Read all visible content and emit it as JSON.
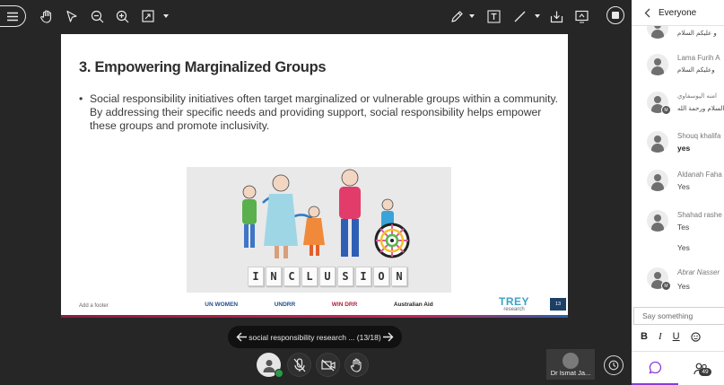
{
  "toolbar": {
    "left_icons": [
      "menu-icon",
      "hand-pan-icon",
      "pointer-icon",
      "zoom-out-icon",
      "zoom-in-icon",
      "fit-page-icon",
      "caret-down-icon"
    ],
    "right_icons": [
      "pen-icon",
      "caret-down-icon",
      "text-tool-icon",
      "line-tool-icon",
      "caret-down-icon",
      "download-icon",
      "share-screen-icon",
      "stop-share-icon"
    ]
  },
  "slide": {
    "title": "3. Empowering Marginalized Groups",
    "bullet": "Social responsibility initiatives often target marginalized or vulnerable groups within a community. By addressing their specific needs and providing support, social responsibility helps empower these groups and promote inclusivity.",
    "image_tiles": [
      "I",
      "N",
      "C",
      "L",
      "U",
      "S",
      "I",
      "O",
      "N"
    ],
    "footer_text": "Add a footer",
    "footer_logos": [
      "UN WOMEN",
      "UNDRR",
      "WIN DRR",
      "Australian Aid"
    ],
    "brand_name": "TREY",
    "brand_sub": "research",
    "slide_number": "13"
  },
  "nav": {
    "title": "social responsibility research ...  (13/18)"
  },
  "participant": {
    "name": "Dr Ismat Ja..."
  },
  "chat": {
    "header": "Everyone",
    "messages": [
      {
        "name": "",
        "text": "و عليكم السلام",
        "rtl": true,
        "badge": false
      },
      {
        "name": "Lama Furih A",
        "text": "وعليكم السلام",
        "rtl_text": true,
        "badge": false
      },
      {
        "name": "امنه اليوسفاوي",
        "text": "وعليكم السلام ورحمة الله",
        "rtl": true,
        "badge": true
      },
      {
        "name": "Shouq khalifa",
        "text": "yes",
        "bold": true,
        "badge": false
      },
      {
        "name": "Aldanah Faha",
        "text": "Yes",
        "badge": false
      },
      {
        "name": "Shahad rashe",
        "text": "Tes",
        "badge": false
      },
      {
        "name": "",
        "text": "Yes",
        "badge": false
      },
      {
        "name": "Abrar Nasser",
        "text": "Yes",
        "badge": true
      }
    ],
    "input_placeholder": "Say something",
    "format_buttons": [
      "B",
      "I",
      "U"
    ],
    "people_count": "49"
  },
  "colors": {
    "stage_bg": "#262626",
    "accent": "#8a3dd9",
    "status_online": "#2b9a48"
  }
}
